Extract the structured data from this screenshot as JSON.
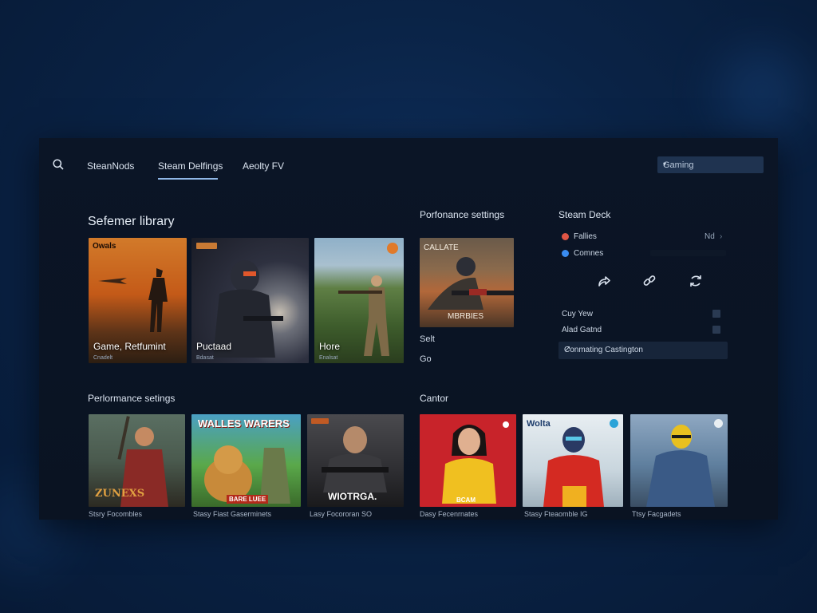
{
  "header": {
    "tabs": [
      {
        "label": "SteanNods"
      },
      {
        "label": "Steam Delfings"
      },
      {
        "label": "Aeolty FV"
      }
    ],
    "dropdown": {
      "value": "Gaming"
    }
  },
  "library": {
    "title": "Sefemer library",
    "cards": [
      {
        "badge": "Owals",
        "title": "Game, Retfumint",
        "sub": "Cnadelt"
      },
      {
        "badge": "",
        "title": "Puctaad",
        "sub": "Bdasat"
      },
      {
        "badge": "",
        "title": "Hore",
        "sub": "Enalsat"
      }
    ]
  },
  "performance_top": {
    "title": "Porfonance settings",
    "card": {
      "top_text": "CALLATE",
      "bottom_text": "MBRBIES"
    },
    "items": [
      "Selt",
      "Go"
    ]
  },
  "steam_deck": {
    "title": "Steam Deck",
    "rows": [
      {
        "label": "Fallies",
        "right": "Nd",
        "dot_color": "#e05545"
      },
      {
        "label": "Comnes",
        "right": "",
        "dot_color": "#3a8cf0"
      }
    ],
    "actions": [
      "share-icon",
      "link-icon",
      "sync-icon"
    ],
    "toggles": [
      {
        "label": "Cuy Yew"
      },
      {
        "label": "Alad Gatnd"
      }
    ],
    "connect": {
      "label": "Conmating Castington",
      "arrow": "↗"
    }
  },
  "performance_bottom": {
    "title": "Perlormance setings",
    "cards": [
      {
        "overlay": "ZUNEXS",
        "caption": "Stsry Focombles"
      },
      {
        "overlay": "WALLES WARERS",
        "overlay2": "BARE LUEE",
        "caption": "Stasy Fiast Gaserminets"
      },
      {
        "overlay": "WIOTRGA.",
        "caption": "Lasy Focororan SO"
      }
    ]
  },
  "cantor": {
    "title": "Cantor",
    "cards": [
      {
        "overlay": "BCAM",
        "caption": "Dasy Fecenrnates"
      },
      {
        "overlay": "Wolta",
        "caption": "Stasy Fteaomble IG"
      },
      {
        "overlay": "",
        "caption": "Ttsy Facgadets"
      }
    ]
  },
  "colors": {
    "background": "#0a2346",
    "panel": "#0b1526",
    "accent": "#8fb6e6"
  }
}
